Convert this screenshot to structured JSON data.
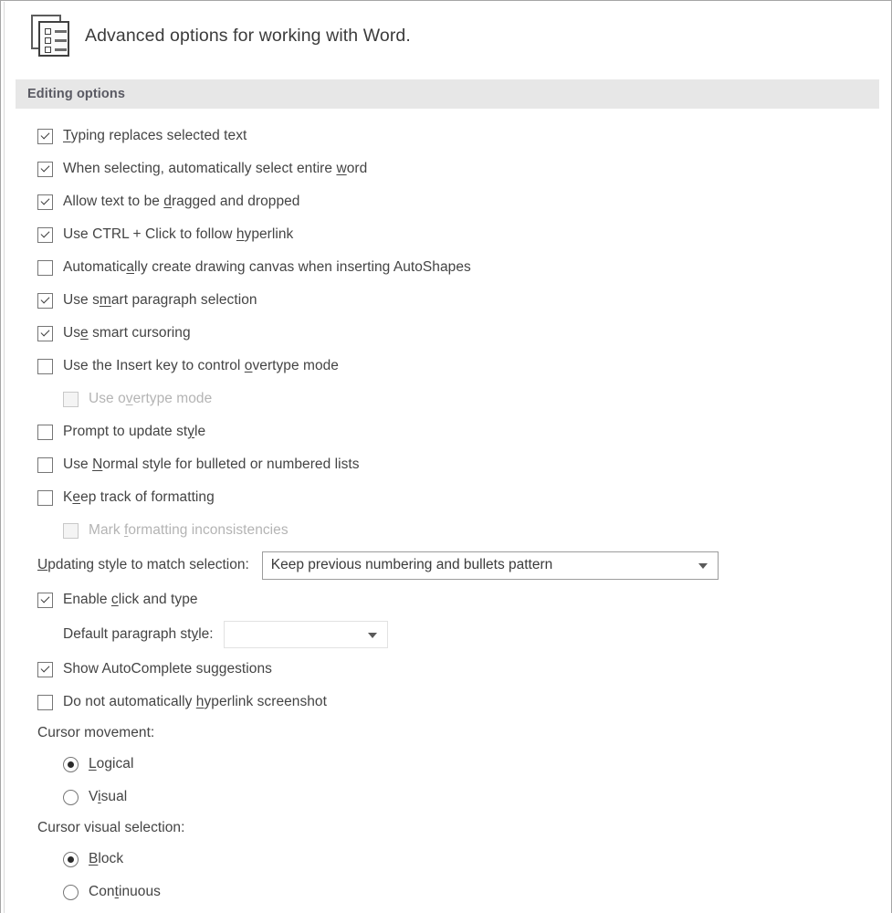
{
  "header": {
    "icon": "document-list-icon",
    "caption": "Advanced options for working with Word."
  },
  "section": {
    "title": "Editing options"
  },
  "options": [
    {
      "type": "checkbox",
      "name": "typing-replaces-selected-text",
      "checked": true,
      "disabled": false,
      "indent": 0,
      "pre": "",
      "accel": "T",
      "post": "yping replaces selected text"
    },
    {
      "type": "checkbox",
      "name": "select-entire-word",
      "checked": true,
      "disabled": false,
      "indent": 0,
      "pre": "When selecting, automatically select entire ",
      "accel": "w",
      "post": "ord"
    },
    {
      "type": "checkbox",
      "name": "drag-and-drop-text",
      "checked": true,
      "disabled": false,
      "indent": 0,
      "pre": "Allow text to be ",
      "accel": "d",
      "post": "ragged and dropped"
    },
    {
      "type": "checkbox",
      "name": "ctrl-click-hyperlink",
      "checked": true,
      "disabled": false,
      "indent": 0,
      "pre": "Use CTRL + Click to follow ",
      "accel": "h",
      "post": "yperlink"
    },
    {
      "type": "checkbox",
      "name": "auto-create-drawing-canvas",
      "checked": false,
      "disabled": false,
      "indent": 0,
      "pre": "Automatic",
      "accel": "a",
      "post": "lly create drawing canvas when inserting AutoShapes"
    },
    {
      "type": "checkbox",
      "name": "smart-paragraph-selection",
      "checked": true,
      "disabled": false,
      "indent": 0,
      "pre": "Use s",
      "accel": "m",
      "post": "art paragraph selection"
    },
    {
      "type": "checkbox",
      "name": "smart-cursoring",
      "checked": true,
      "disabled": false,
      "indent": 0,
      "pre": "Us",
      "accel": "e",
      "post": " smart cursoring"
    },
    {
      "type": "checkbox",
      "name": "insert-key-overtype",
      "checked": false,
      "disabled": false,
      "indent": 0,
      "pre": "Use the Insert key to control ",
      "accel": "o",
      "post": "vertype mode"
    },
    {
      "type": "checkbox",
      "name": "use-overtype-mode",
      "checked": false,
      "disabled": true,
      "indent": 1,
      "pre": "Use o",
      "accel": "v",
      "post": "ertype mode"
    },
    {
      "type": "checkbox",
      "name": "prompt-to-update-style",
      "checked": false,
      "disabled": false,
      "indent": 0,
      "pre": "Prompt to update st",
      "accel": "y",
      "post": "le"
    },
    {
      "type": "checkbox",
      "name": "normal-style-for-lists",
      "checked": false,
      "disabled": false,
      "indent": 0,
      "pre": "Use ",
      "accel": "N",
      "post": "ormal style for bulleted or numbered lists"
    },
    {
      "type": "checkbox",
      "name": "keep-track-of-formatting",
      "checked": false,
      "disabled": false,
      "indent": 0,
      "pre": "K",
      "accel": "e",
      "post": "ep track of formatting"
    },
    {
      "type": "checkbox",
      "name": "mark-formatting-inconsistencies",
      "checked": false,
      "disabled": true,
      "indent": 1,
      "pre": "Mark ",
      "accel": "f",
      "post": "ormatting inconsistencies"
    }
  ],
  "updating_style": {
    "label_pre": "",
    "label_accel": "U",
    "label_post": "pdating style to match selection:",
    "value": "Keep previous numbering and bullets pattern",
    "arrow": "chevron-down-icon"
  },
  "enable_click_and_type": {
    "checked": true,
    "pre": "Enable ",
    "accel": "c",
    "post": "lick and type"
  },
  "default_paragraph_style": {
    "label_pre": "Default paragraph st",
    "label_accel": "y",
    "label_post": "le:",
    "value": "",
    "arrow": "chevron-down-icon"
  },
  "options_tail": [
    {
      "type": "checkbox",
      "name": "show-autocomplete-suggestions",
      "checked": true,
      "disabled": false,
      "indent": 0,
      "pre": "Show AutoComplete suggestions",
      "accel": "",
      "post": ""
    },
    {
      "type": "checkbox",
      "name": "no-auto-hyperlink-screenshot",
      "checked": false,
      "disabled": false,
      "indent": 0,
      "pre": "Do not automatically ",
      "accel": "h",
      "post": "yperlink screenshot"
    }
  ],
  "cursor_movement": {
    "caption": "Cursor movement:",
    "selected": "Logical",
    "choices": [
      {
        "name": "cursor-movement-logical",
        "checked": true,
        "pre": "",
        "accel": "L",
        "post": "ogical"
      },
      {
        "name": "cursor-movement-visual",
        "checked": false,
        "pre": "V",
        "accel": "i",
        "post": "sual"
      }
    ]
  },
  "cursor_visual_selection": {
    "caption": "Cursor visual selection:",
    "selected": "Block",
    "choices": [
      {
        "name": "cursor-visual-block",
        "checked": true,
        "pre": "",
        "accel": "B",
        "post": "lock"
      },
      {
        "name": "cursor-visual-continuous",
        "checked": false,
        "pre": "Con",
        "accel": "t",
        "post": "inuous"
      }
    ]
  },
  "colors": {
    "text": "#444444",
    "band_bg": "#e7e7e7",
    "band_text": "#5a5a63",
    "disabled_text": "#b4b4b4",
    "border": "#a6a6a6"
  }
}
